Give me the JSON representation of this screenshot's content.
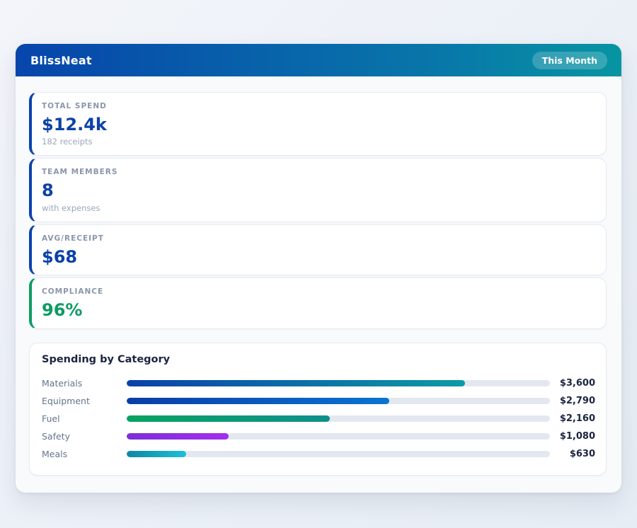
{
  "header": {
    "title": "BlissNeat",
    "badge": "This Month",
    "gradient_from": "#0745ab",
    "gradient_to": "#0795a2"
  },
  "colors": {
    "stat_accent_blue": "#0a43ad",
    "stat_accent_green": "#0d9b63",
    "stat_label_gray": "#8b96ab",
    "panel_body_bg": "#f8fafc",
    "bar_track": "#e3e8f0"
  },
  "stats": [
    {
      "label": "TOTAL SPEND",
      "value": "$12.4k",
      "sub": "182 receipts"
    },
    {
      "label": "TEAM MEMBERS",
      "value": "8",
      "sub": "with expenses"
    },
    {
      "label": "AVG/RECEIPT",
      "value": "$68"
    },
    {
      "label": "COMPLIANCE",
      "value": "96%"
    }
  ],
  "chart": {
    "title": "Spending by Category",
    "rows": [
      {
        "label": "Materials",
        "value_label": "$3,600",
        "fill_style": "width:80%"
      },
      {
        "label": "Equipment",
        "value_label": "$2,790",
        "fill_style": "width:62%"
      },
      {
        "label": "Fuel",
        "value_label": "$2,160",
        "fill_style": "width:48%"
      },
      {
        "label": "Safety",
        "value_label": "$1,080",
        "fill_style": "width:24%"
      },
      {
        "label": "Meals",
        "value_label": "$630",
        "fill_style": "width:14%"
      }
    ]
  },
  "chart_data": {
    "type": "bar",
    "orientation": "horizontal",
    "title": "Spending by Category",
    "categories": [
      "Materials",
      "Equipment",
      "Fuel",
      "Safety",
      "Meals"
    ],
    "values": [
      3600,
      2790,
      2160,
      1080,
      630
    ],
    "value_labels": [
      "$3,600",
      "$2,790",
      "$2,160",
      "$1,080",
      "$630"
    ],
    "xlim": [
      0,
      4500
    ],
    "grid": false,
    "legend": false,
    "track_color": "#e3e8f0",
    "bar_colors": [
      [
        "#0a41a8",
        "#0d9aa6"
      ],
      [
        "#0a3da6",
        "#0b74d1"
      ],
      [
        "#07a361",
        "#0f8f8c"
      ],
      [
        "#7c2fd8",
        "#a32ded"
      ],
      [
        "#0f87a3",
        "#1cc0d6"
      ]
    ]
  }
}
